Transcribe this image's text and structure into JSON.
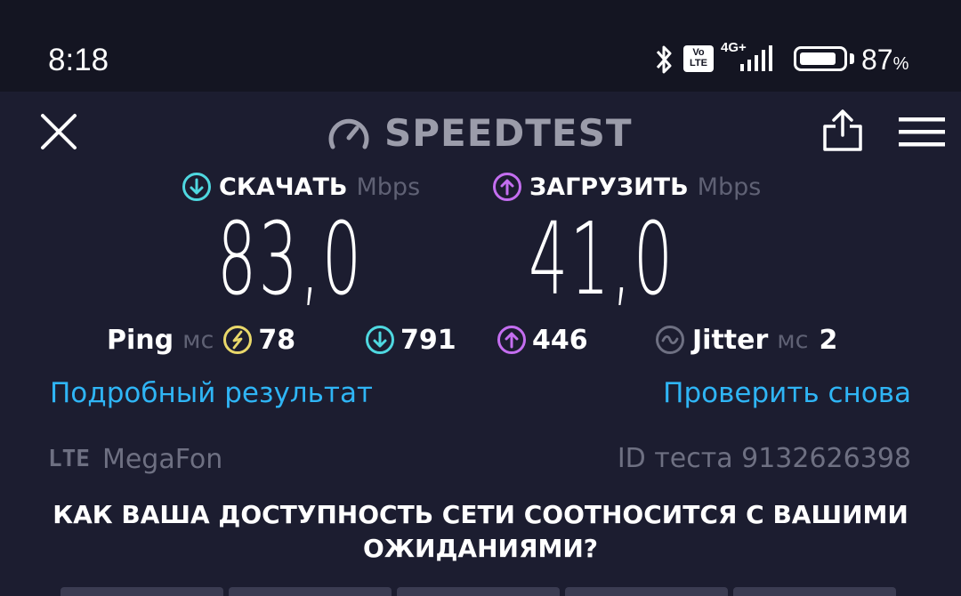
{
  "status_bar": {
    "time": "8:18",
    "network_type": "4G+",
    "volte_top": "Vo",
    "volte_bottom": "LTE",
    "battery_percent_value": "87",
    "battery_percent_sign": "%",
    "battery_level": 0.87,
    "icons": [
      "bluetooth-icon",
      "volte-icon",
      "signal-icon",
      "battery-icon"
    ]
  },
  "header": {
    "app_title": "SPEEDTEST",
    "close_icon": "close-icon",
    "share_icon": "share-icon",
    "menu_icon": "menu-icon"
  },
  "results": {
    "download": {
      "label": "СКАЧАТЬ",
      "unit": "Mbps",
      "value": "83,0",
      "icon": "download-arrow-icon",
      "color": "#4fd8e0"
    },
    "upload": {
      "label": "ЗАГРУЗИТЬ",
      "unit": "Mbps",
      "value": "41,0",
      "icon": "upload-arrow-icon",
      "color": "#c46ef0"
    }
  },
  "metrics": {
    "ping": {
      "label": "Ping",
      "unit": "мс",
      "value": "78",
      "icon_color": "#e9d86a"
    },
    "download_latency": {
      "value": "791"
    },
    "upload_latency": {
      "value": "446"
    },
    "jitter": {
      "label": "Jitter",
      "unit": "мс",
      "value": "2"
    }
  },
  "links": {
    "detailed_result": "Подробный результат",
    "test_again": "Проверить снова"
  },
  "connection": {
    "type": "LTE",
    "provider": "MegaFon",
    "test_id": "ID теста 9132626398"
  },
  "survey": {
    "question": "КАК ВАША ДОСТУПНОСТЬ СЕТИ СООТНОСИТСЯ С ВАШИМИ ОЖИДАНИЯМИ?"
  },
  "colors": {
    "background": "#1c1d30",
    "statusbar": "#141522",
    "link": "#2fb5f5",
    "muted": "#6e7082"
  }
}
